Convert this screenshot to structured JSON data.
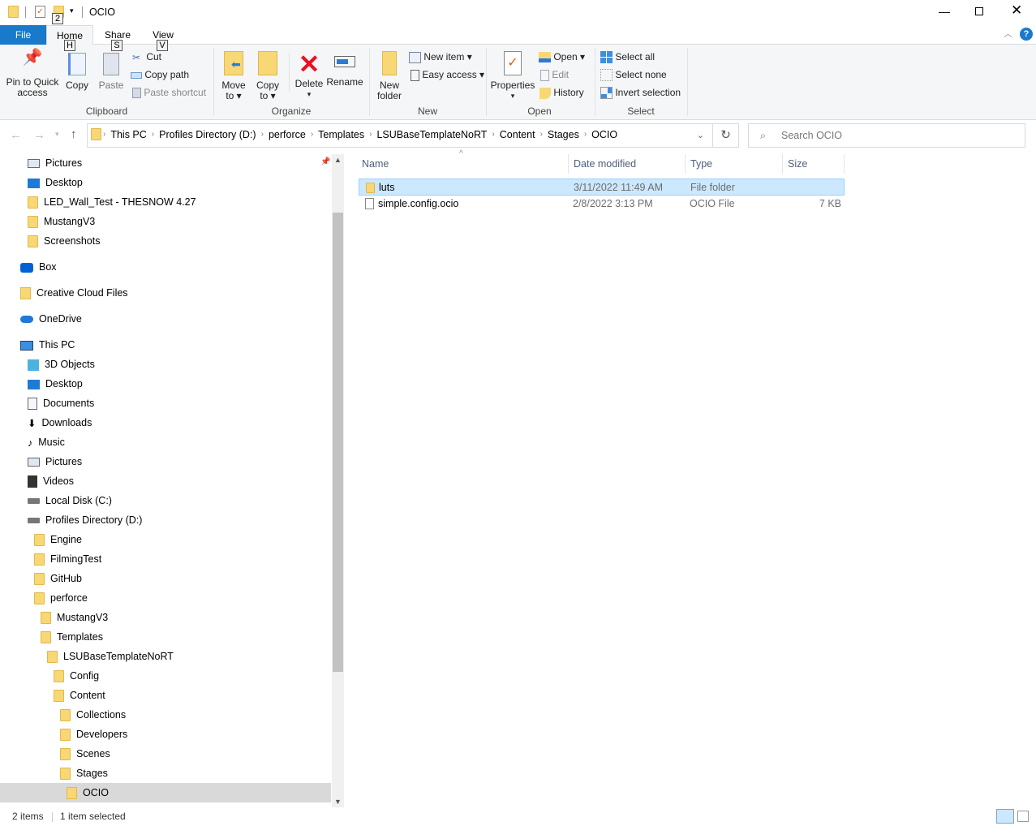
{
  "window": {
    "title": "OCIO",
    "qat_keytip": "2",
    "controls": [
      "minimize",
      "maximize",
      "close"
    ]
  },
  "ribbon_tabs": [
    {
      "label": "File",
      "active": false
    },
    {
      "label": "Home",
      "keytip": "H",
      "active": true
    },
    {
      "label": "Share",
      "keytip": "S"
    },
    {
      "label": "View",
      "keytip": "V"
    }
  ],
  "clipboard": {
    "label": "Clipboard",
    "pin": "Pin to Quick access",
    "pin_l1": "Pin to Quick",
    "pin_l2": "access",
    "copy": "Copy",
    "paste": "Paste",
    "cut": "Cut",
    "copy_path": "Copy path",
    "paste_shortcut": "Paste shortcut"
  },
  "organize": {
    "label": "Organize",
    "move_l1": "Move",
    "move_l2": "to",
    "copy_l1": "Copy",
    "copy_l2": "to",
    "delete": "Delete",
    "rename": "Rename"
  },
  "new": {
    "label": "New",
    "folder_l1": "New",
    "folder_l2": "folder",
    "new_item": "New item",
    "easy_access": "Easy access"
  },
  "open": {
    "label": "Open",
    "properties": "Properties",
    "open": "Open",
    "edit": "Edit",
    "history": "History"
  },
  "select": {
    "label": "Select",
    "select_all": "Select all",
    "select_none": "Select none",
    "invert": "Invert selection"
  },
  "address": {
    "crumbs": [
      "This PC",
      "Profiles Directory (D:)",
      "perforce",
      "Templates",
      "LSUBaseTemplateNoRT",
      "Content",
      "Stages",
      "OCIO"
    ]
  },
  "search": {
    "placeholder": "Search OCIO"
  },
  "nav": [
    {
      "label": "Pictures",
      "icon": "pictures",
      "depth": 1
    },
    {
      "label": "Desktop",
      "icon": "desktop",
      "depth": 1
    },
    {
      "label": "LED_Wall_Test - THESNOW 4.27",
      "icon": "folder",
      "depth": 1
    },
    {
      "label": "MustangV3",
      "icon": "folder",
      "depth": 1
    },
    {
      "label": "Screenshots",
      "icon": "folder",
      "depth": 1
    },
    {
      "label": "Box",
      "icon": "box",
      "depth": 0,
      "group_start": true
    },
    {
      "label": "Creative Cloud Files",
      "icon": "creative-cloud",
      "depth": 0,
      "group_start": true
    },
    {
      "label": "OneDrive",
      "icon": "onedrive",
      "depth": 0,
      "group_start": true
    },
    {
      "label": "This PC",
      "icon": "this-pc",
      "depth": 0,
      "group_start": true
    },
    {
      "label": "3D Objects",
      "icon": "3d-objects",
      "depth": 1
    },
    {
      "label": "Desktop",
      "icon": "desktop",
      "depth": 1
    },
    {
      "label": "Documents",
      "icon": "documents",
      "depth": 1
    },
    {
      "label": "Downloads",
      "icon": "downloads",
      "depth": 1
    },
    {
      "label": "Music",
      "icon": "music",
      "depth": 1
    },
    {
      "label": "Pictures",
      "icon": "pictures",
      "depth": 1
    },
    {
      "label": "Videos",
      "icon": "videos",
      "depth": 1
    },
    {
      "label": "Local Disk (C:)",
      "icon": "drive",
      "depth": 1
    },
    {
      "label": "Profiles Directory (D:)",
      "icon": "drive",
      "depth": 1
    },
    {
      "label": "Engine",
      "icon": "folder",
      "depth": 2
    },
    {
      "label": "FilmingTest",
      "icon": "folder",
      "depth": 2
    },
    {
      "label": "GitHub",
      "icon": "folder",
      "depth": 2
    },
    {
      "label": "perforce",
      "icon": "folder",
      "depth": 2
    },
    {
      "label": "MustangV3",
      "icon": "folder",
      "depth": 3
    },
    {
      "label": "Templates",
      "icon": "folder",
      "depth": 3
    },
    {
      "label": "LSUBaseTemplateNoRT",
      "icon": "folder",
      "depth": 4
    },
    {
      "label": "Config",
      "icon": "folder",
      "depth": 5
    },
    {
      "label": "Content",
      "icon": "folder",
      "depth": 5
    },
    {
      "label": "Collections",
      "icon": "folder",
      "depth": 6
    },
    {
      "label": "Developers",
      "icon": "folder",
      "depth": 6
    },
    {
      "label": "Scenes",
      "icon": "folder",
      "depth": 6
    },
    {
      "label": "Stages",
      "icon": "folder",
      "depth": 6
    },
    {
      "label": "OCIO",
      "icon": "folder",
      "depth": 7,
      "selected": true
    }
  ],
  "columns": {
    "name": "Name",
    "date": "Date modified",
    "type": "Type",
    "size": "Size"
  },
  "files": [
    {
      "name": "luts",
      "date": "3/11/2022 11:49 AM",
      "type": "File folder",
      "size": "",
      "selected": true,
      "icon": "folder"
    },
    {
      "name": "simple.config.ocio",
      "date": "2/8/2022 3:13 PM",
      "type": "OCIO File",
      "size": "7 KB",
      "selected": false,
      "icon": "file"
    }
  ],
  "status": {
    "items": "2 items",
    "selected": "1 item selected"
  },
  "colors": {
    "accent": "#1979ca",
    "selection": "#cce8ff",
    "folder": "#f8d775"
  }
}
